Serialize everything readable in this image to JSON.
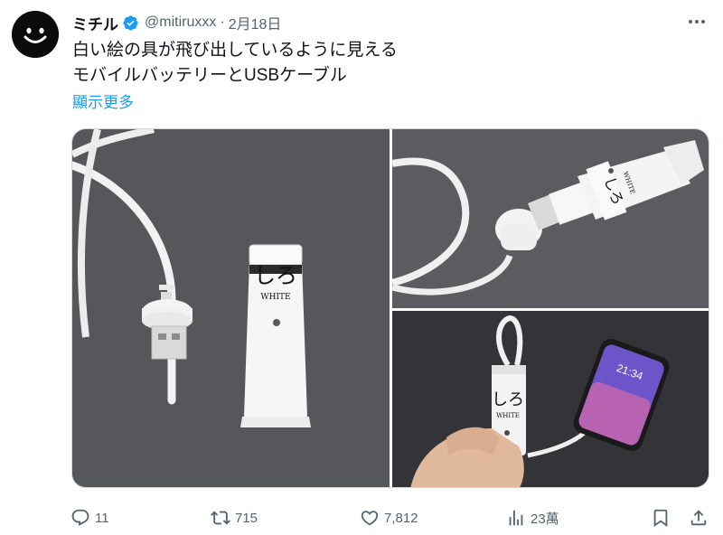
{
  "author": {
    "display_name": "ミチル",
    "handle": "@mitiruxxx",
    "separator": "·",
    "date": "2月18日"
  },
  "icons": {
    "avatar": "smiley-face-avatar",
    "verified": "verified-badge-icon",
    "more": "more-options-icon",
    "reply": "reply-icon",
    "retweet": "retweet-icon",
    "like": "heart-icon",
    "views": "views-bar-chart-icon",
    "bookmark": "bookmark-icon",
    "share": "share-icon"
  },
  "tweet": {
    "lines": [
      "白い絵の具が飛び出しているように見える",
      "モバイルバッテリーとUSBケーブル"
    ],
    "show_more": "顯示更多"
  },
  "media": {
    "photos": [
      {
        "name": "paint-tube-battery-with-usb-cable",
        "tube_label": "しろ",
        "tube_sublabel": "WHITE"
      },
      {
        "name": "battery-with-usb-plugged-into-cap",
        "tube_label": "しろ",
        "tube_sublabel": "WHITE"
      },
      {
        "name": "hand-holding-battery-charging-phone",
        "tube_label": "しろ",
        "tube_sublabel": "WHITE",
        "phone_time": "21:34"
      }
    ]
  },
  "actions": {
    "reply_count": "11",
    "retweet_count": "715",
    "like_count": "7,812",
    "views_count": "23萬"
  },
  "colors": {
    "accent": "#1d9bf0",
    "text": "#0f1419",
    "muted": "#536471",
    "border": "#cfd9de"
  }
}
